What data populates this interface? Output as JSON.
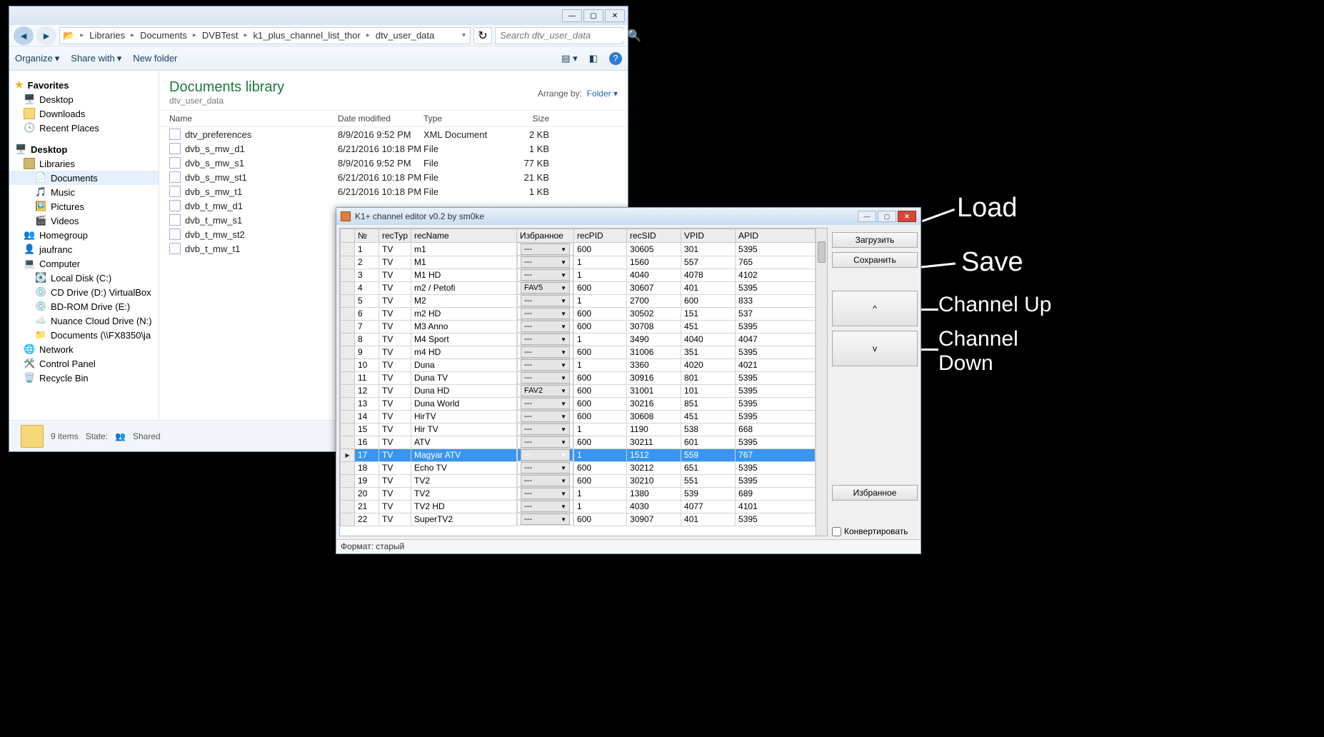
{
  "explorer": {
    "breadcrumb": [
      "Libraries",
      "Documents",
      "DVBTest",
      "k1_plus_channel_list_thor",
      "dtv_user_data"
    ],
    "search_placeholder": "Search dtv_user_data",
    "toolbar": {
      "organize": "Organize",
      "share": "Share with",
      "newfolder": "New folder"
    },
    "nav": {
      "favorites": "Favorites",
      "desktop": "Desktop",
      "downloads": "Downloads",
      "recent": "Recent Places",
      "desktop2": "Desktop",
      "libraries": "Libraries",
      "documents": "Documents",
      "music": "Music",
      "pictures": "Pictures",
      "videos": "Videos",
      "homegroup": "Homegroup",
      "jaufranc": "jaufranc",
      "computer": "Computer",
      "localc": "Local Disk (C:)",
      "cdd": "CD Drive (D:) VirtualBox",
      "bde": "BD-ROM Drive (E:)",
      "ncd": "Nuance Cloud Drive (N:)",
      "docs": "Documents (\\\\FX8350\\ja",
      "network": "Network",
      "cpanel": "Control Panel",
      "recycle": "Recycle Bin"
    },
    "lib_title": "Documents library",
    "lib_sub": "dtv_user_data",
    "arrange": "Arrange by:",
    "arrange_val": "Folder",
    "cols": {
      "name": "Name",
      "date": "Date modified",
      "type": "Type",
      "size": "Size"
    },
    "files": [
      {
        "name": "dtv_preferences",
        "date": "8/9/2016 9:52 PM",
        "type": "XML Document",
        "size": "2 KB"
      },
      {
        "name": "dvb_s_mw_d1",
        "date": "6/21/2016 10:18 PM",
        "type": "File",
        "size": "1 KB"
      },
      {
        "name": "dvb_s_mw_s1",
        "date": "8/9/2016 9:52 PM",
        "type": "File",
        "size": "77 KB"
      },
      {
        "name": "dvb_s_mw_st1",
        "date": "6/21/2016 10:18 PM",
        "type": "File",
        "size": "21 KB"
      },
      {
        "name": "dvb_s_mw_t1",
        "date": "6/21/2016 10:18 PM",
        "type": "File",
        "size": "1 KB"
      },
      {
        "name": "dvb_t_mw_d1",
        "date": "",
        "type": "",
        "size": ""
      },
      {
        "name": "dvb_t_mw_s1",
        "date": "",
        "type": "",
        "size": ""
      },
      {
        "name": "dvb_t_mw_st2",
        "date": "",
        "type": "",
        "size": ""
      },
      {
        "name": "dvb_t_mw_t1",
        "date": "",
        "type": "",
        "size": ""
      }
    ],
    "status": {
      "count": "9 items",
      "state_lbl": "State:",
      "state_val": "Shared"
    }
  },
  "chedit": {
    "title": "K1+ channel editor v0.2 by sm0ke",
    "cols": {
      "no": "№",
      "rectype": "recTyp",
      "recname": "recName",
      "fav": "Избранное",
      "recpid": "recPID",
      "recsid": "recSID",
      "vpid": "VPID",
      "apid": "APID"
    },
    "rows": [
      {
        "n": "1",
        "t": "TV",
        "name": "m1",
        "fav": "---",
        "pid": "600",
        "sid": "30605",
        "vpid": "301",
        "apid": "5395"
      },
      {
        "n": "2",
        "t": "TV",
        "name": "M1",
        "fav": "---",
        "pid": "1",
        "sid": "1560",
        "vpid": "557",
        "apid": "765"
      },
      {
        "n": "3",
        "t": "TV",
        "name": "M1 HD",
        "fav": "---",
        "pid": "1",
        "sid": "4040",
        "vpid": "4078",
        "apid": "4102"
      },
      {
        "n": "4",
        "t": "TV",
        "name": "m2 / Petofi",
        "fav": "FAV5",
        "pid": "600",
        "sid": "30607",
        "vpid": "401",
        "apid": "5395"
      },
      {
        "n": "5",
        "t": "TV",
        "name": "M2",
        "fav": "---",
        "pid": "1",
        "sid": "2700",
        "vpid": "600",
        "apid": "833"
      },
      {
        "n": "6",
        "t": "TV",
        "name": "m2 HD",
        "fav": "---",
        "pid": "600",
        "sid": "30502",
        "vpid": "151",
        "apid": "537"
      },
      {
        "n": "7",
        "t": "TV",
        "name": "M3 Anno",
        "fav": "---",
        "pid": "600",
        "sid": "30708",
        "vpid": "451",
        "apid": "5395"
      },
      {
        "n": "8",
        "t": "TV",
        "name": "M4 Sport",
        "fav": "---",
        "pid": "1",
        "sid": "3490",
        "vpid": "4040",
        "apid": "4047"
      },
      {
        "n": "9",
        "t": "TV",
        "name": "m4 HD",
        "fav": "---",
        "pid": "600",
        "sid": "31006",
        "vpid": "351",
        "apid": "5395"
      },
      {
        "n": "10",
        "t": "TV",
        "name": "Duna",
        "fav": "---",
        "pid": "1",
        "sid": "3360",
        "vpid": "4020",
        "apid": "4021"
      },
      {
        "n": "11",
        "t": "TV",
        "name": "Duna TV",
        "fav": "---",
        "pid": "600",
        "sid": "30916",
        "vpid": "801",
        "apid": "5395"
      },
      {
        "n": "12",
        "t": "TV",
        "name": "Duna HD",
        "fav": "FAV2",
        "pid": "600",
        "sid": "31001",
        "vpid": "101",
        "apid": "5395"
      },
      {
        "n": "13",
        "t": "TV",
        "name": "Duna World",
        "fav": "---",
        "pid": "600",
        "sid": "30216",
        "vpid": "851",
        "apid": "5395"
      },
      {
        "n": "14",
        "t": "TV",
        "name": "HirTV",
        "fav": "---",
        "pid": "600",
        "sid": "30608",
        "vpid": "451",
        "apid": "5395"
      },
      {
        "n": "15",
        "t": "TV",
        "name": "Hir TV",
        "fav": "---",
        "pid": "1",
        "sid": "1190",
        "vpid": "538",
        "apid": "668"
      },
      {
        "n": "16",
        "t": "TV",
        "name": "ATV",
        "fav": "---",
        "pid": "600",
        "sid": "30211",
        "vpid": "601",
        "apid": "5395"
      },
      {
        "n": "17",
        "t": "TV",
        "name": "Magyar ATV",
        "fav": "---",
        "pid": "1",
        "sid": "1512",
        "vpid": "559",
        "apid": "767",
        "sel": true
      },
      {
        "n": "18",
        "t": "TV",
        "name": "Echo TV",
        "fav": "---",
        "pid": "600",
        "sid": "30212",
        "vpid": "651",
        "apid": "5395"
      },
      {
        "n": "19",
        "t": "TV",
        "name": "TV2",
        "fav": "---",
        "pid": "600",
        "sid": "30210",
        "vpid": "551",
        "apid": "5395"
      },
      {
        "n": "20",
        "t": "TV",
        "name": "TV2",
        "fav": "---",
        "pid": "1",
        "sid": "1380",
        "vpid": "539",
        "apid": "689"
      },
      {
        "n": "21",
        "t": "TV",
        "name": "TV2 HD",
        "fav": "---",
        "pid": "1",
        "sid": "4030",
        "vpid": "4077",
        "apid": "4101"
      },
      {
        "n": "22",
        "t": "TV",
        "name": "SuperTV2",
        "fav": "---",
        "pid": "600",
        "sid": "30907",
        "vpid": "401",
        "apid": "5395"
      }
    ],
    "buttons": {
      "load": "Загрузить",
      "save": "Сохранить",
      "up": "^",
      "down": "v",
      "fav": "Избранное",
      "convert": "Конвертировать"
    },
    "status": "Формат:  старый"
  },
  "anno": {
    "load": "Load",
    "save": "Save",
    "up": "Channel Up",
    "down": "Channel\nDown"
  }
}
